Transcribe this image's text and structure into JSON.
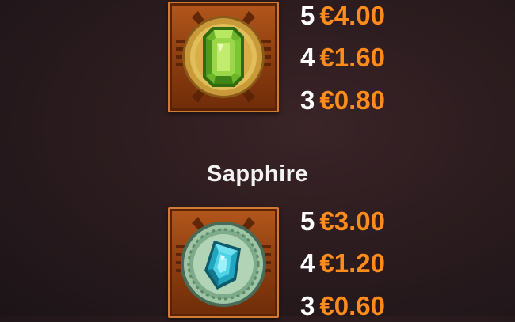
{
  "colors": {
    "background": "#2c1c1f",
    "count_text": "#ffffff",
    "payout_text": "#ff8c1a",
    "title_text": "#f2f2f2",
    "tile_frame": "#a84e18"
  },
  "symbols": [
    {
      "title": "",
      "icon": "emerald-gem-icon",
      "payouts": [
        {
          "count": "5",
          "amount": "€4.00"
        },
        {
          "count": "4",
          "amount": "€1.60"
        },
        {
          "count": "3",
          "amount": "€0.80"
        }
      ]
    },
    {
      "title": "Sapphire",
      "icon": "sapphire-gem-icon",
      "payouts": [
        {
          "count": "5",
          "amount": "€3.00"
        },
        {
          "count": "4",
          "amount": "€1.20"
        },
        {
          "count": "3",
          "amount": "€0.60"
        }
      ]
    }
  ]
}
